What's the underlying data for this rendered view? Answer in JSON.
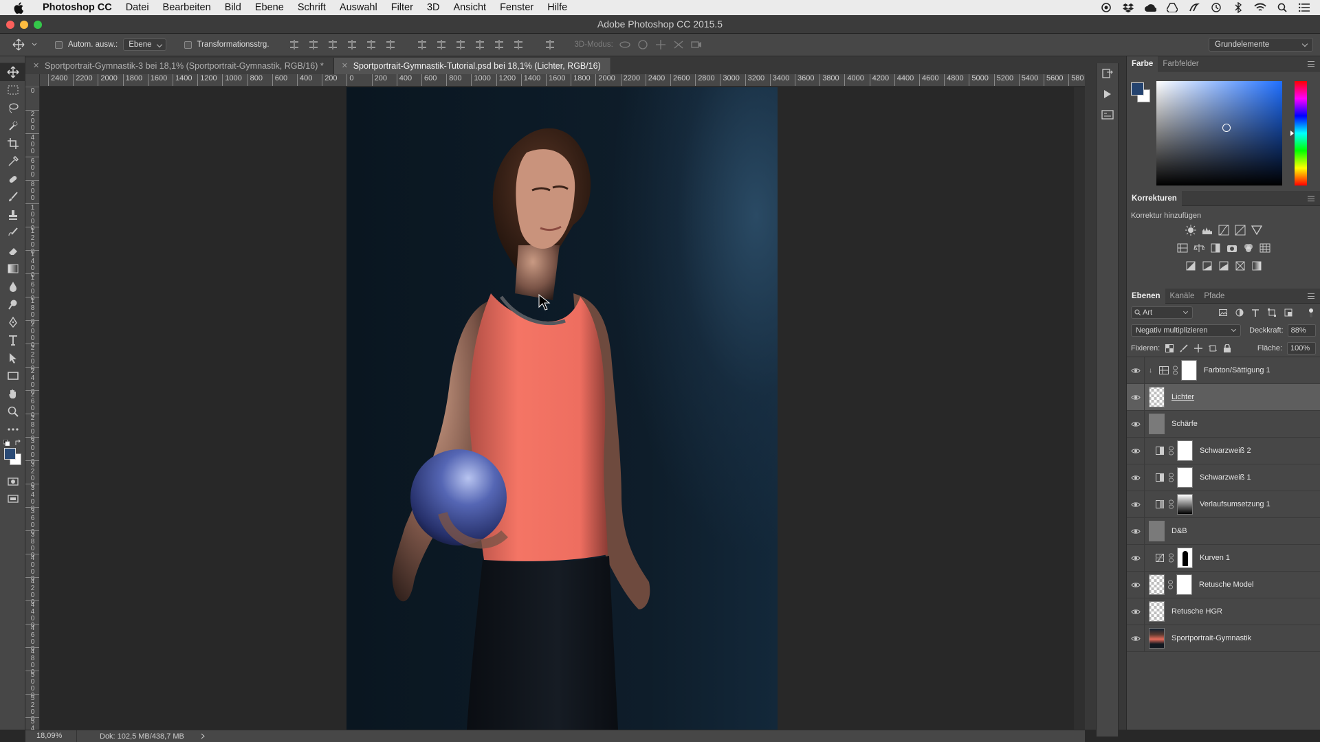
{
  "menubar": {
    "app": "Photoshop CC",
    "items": [
      "Datei",
      "Bearbeiten",
      "Bild",
      "Ebene",
      "Schrift",
      "Auswahl",
      "Filter",
      "3D",
      "Ansicht",
      "Fenster",
      "Hilfe"
    ]
  },
  "window": {
    "title": "Adobe Photoshop CC 2015.5"
  },
  "options": {
    "auto_select_label": "Autom. ausw.:",
    "auto_select_value": "Ebene",
    "transform_label": "Transformationsstrg.",
    "mode3d_label": "3D-Modus:",
    "workspace": "Grundelemente"
  },
  "tabs": [
    {
      "label": "Sportportrait-Gymnastik-3 bei 18,1% (Sportportrait-Gymnastik, RGB/16) *",
      "active": false
    },
    {
      "label": "Sportportrait-Gymnastik-Tutorial.psd bei 18,1% (Lichter, RGB/16)",
      "active": true
    }
  ],
  "ruler": {
    "h_ticks": [
      "2400",
      "2200",
      "2000",
      "1800",
      "1600",
      "1400",
      "1200",
      "1000",
      "800",
      "600",
      "400",
      "200",
      "0",
      "200",
      "400",
      "600",
      "800",
      "1000",
      "1200",
      "1400",
      "1600",
      "1800",
      "2000",
      "2200",
      "2400",
      "2600",
      "2800",
      "3000",
      "3200",
      "3400",
      "3600",
      "3800",
      "4000",
      "4200",
      "4400",
      "4600",
      "4800",
      "5000",
      "5200",
      "5400",
      "5600",
      "580"
    ],
    "v_ticks": [
      "0",
      "2\n0\n0",
      "4\n0\n0",
      "6\n0\n0",
      "8\n0\n0",
      "1\n0\n0\n0",
      "1\n2\n0\n0",
      "1\n4\n0\n0",
      "1\n6\n0\n0",
      "1\n8\n0\n0",
      "2\n0\n0\n0",
      "2\n2\n0\n0",
      "2\n4\n0\n0",
      "2\n6\n0\n0",
      "2\n8\n0\n0",
      "3\n0\n0\n0",
      "3\n2\n0\n0",
      "3\n4\n0\n0",
      "3\n6\n0\n0",
      "3\n8\n0\n0",
      "4\n0\n0\n0",
      "4\n2\n0\n0",
      "4\n4\n0\n0",
      "4\n6\n0\n0",
      "4\n8\n0\n0",
      "5\n0\n0\n0",
      "5\n2\n0\n0",
      "5\n4\n0\n0"
    ]
  },
  "status": {
    "zoom": "18,09%",
    "doc": "Dok: 102,5 MB/438,7 MB"
  },
  "color_panel": {
    "tabs": [
      "Farbe",
      "Farbfelder"
    ],
    "foreground": "#24436f",
    "background": "#ffffff"
  },
  "adjustments": {
    "title": "Korrekturen",
    "subtitle": "Korrektur hinzufügen"
  },
  "layers_panel": {
    "tabs": [
      "Ebenen",
      "Kanäle",
      "Pfade"
    ],
    "filter_kind": "Art",
    "blend_mode": "Negativ multiplizieren",
    "opacity_label": "Deckkraft:",
    "opacity": "88%",
    "lock_label": "Fixieren:",
    "fill_label": "Fläche:",
    "fill": "100%",
    "layers": [
      {
        "name": "Farbton/Sättigung 1",
        "type": "adjustment-hue",
        "selected": false
      },
      {
        "name": "Lichter",
        "type": "pixel-transparent",
        "selected": true
      },
      {
        "name": "Schärfe",
        "type": "pixel-gray",
        "selected": false
      },
      {
        "name": "Schwarzweiß 2",
        "type": "adjustment-bw",
        "selected": false
      },
      {
        "name": "Schwarzweiß 1",
        "type": "adjustment-bw",
        "selected": false
      },
      {
        "name": "Verlaufsumsetzung 1",
        "type": "adjustment-gradient",
        "selected": false
      },
      {
        "name": "D&B",
        "type": "pixel-gray",
        "selected": false
      },
      {
        "name": "Kurven 1",
        "type": "adjustment-curves",
        "selected": false
      },
      {
        "name": "Retusche Model",
        "type": "pixel-masked",
        "selected": false
      },
      {
        "name": "Retusche HGR",
        "type": "pixel-transparent",
        "selected": false
      },
      {
        "name": "Sportportrait-Gymnastik",
        "type": "photo",
        "selected": false
      }
    ]
  },
  "colors": {
    "accent": "#1f6fff",
    "shirt": "#ef6f61",
    "ball": "#3a4c9a"
  }
}
